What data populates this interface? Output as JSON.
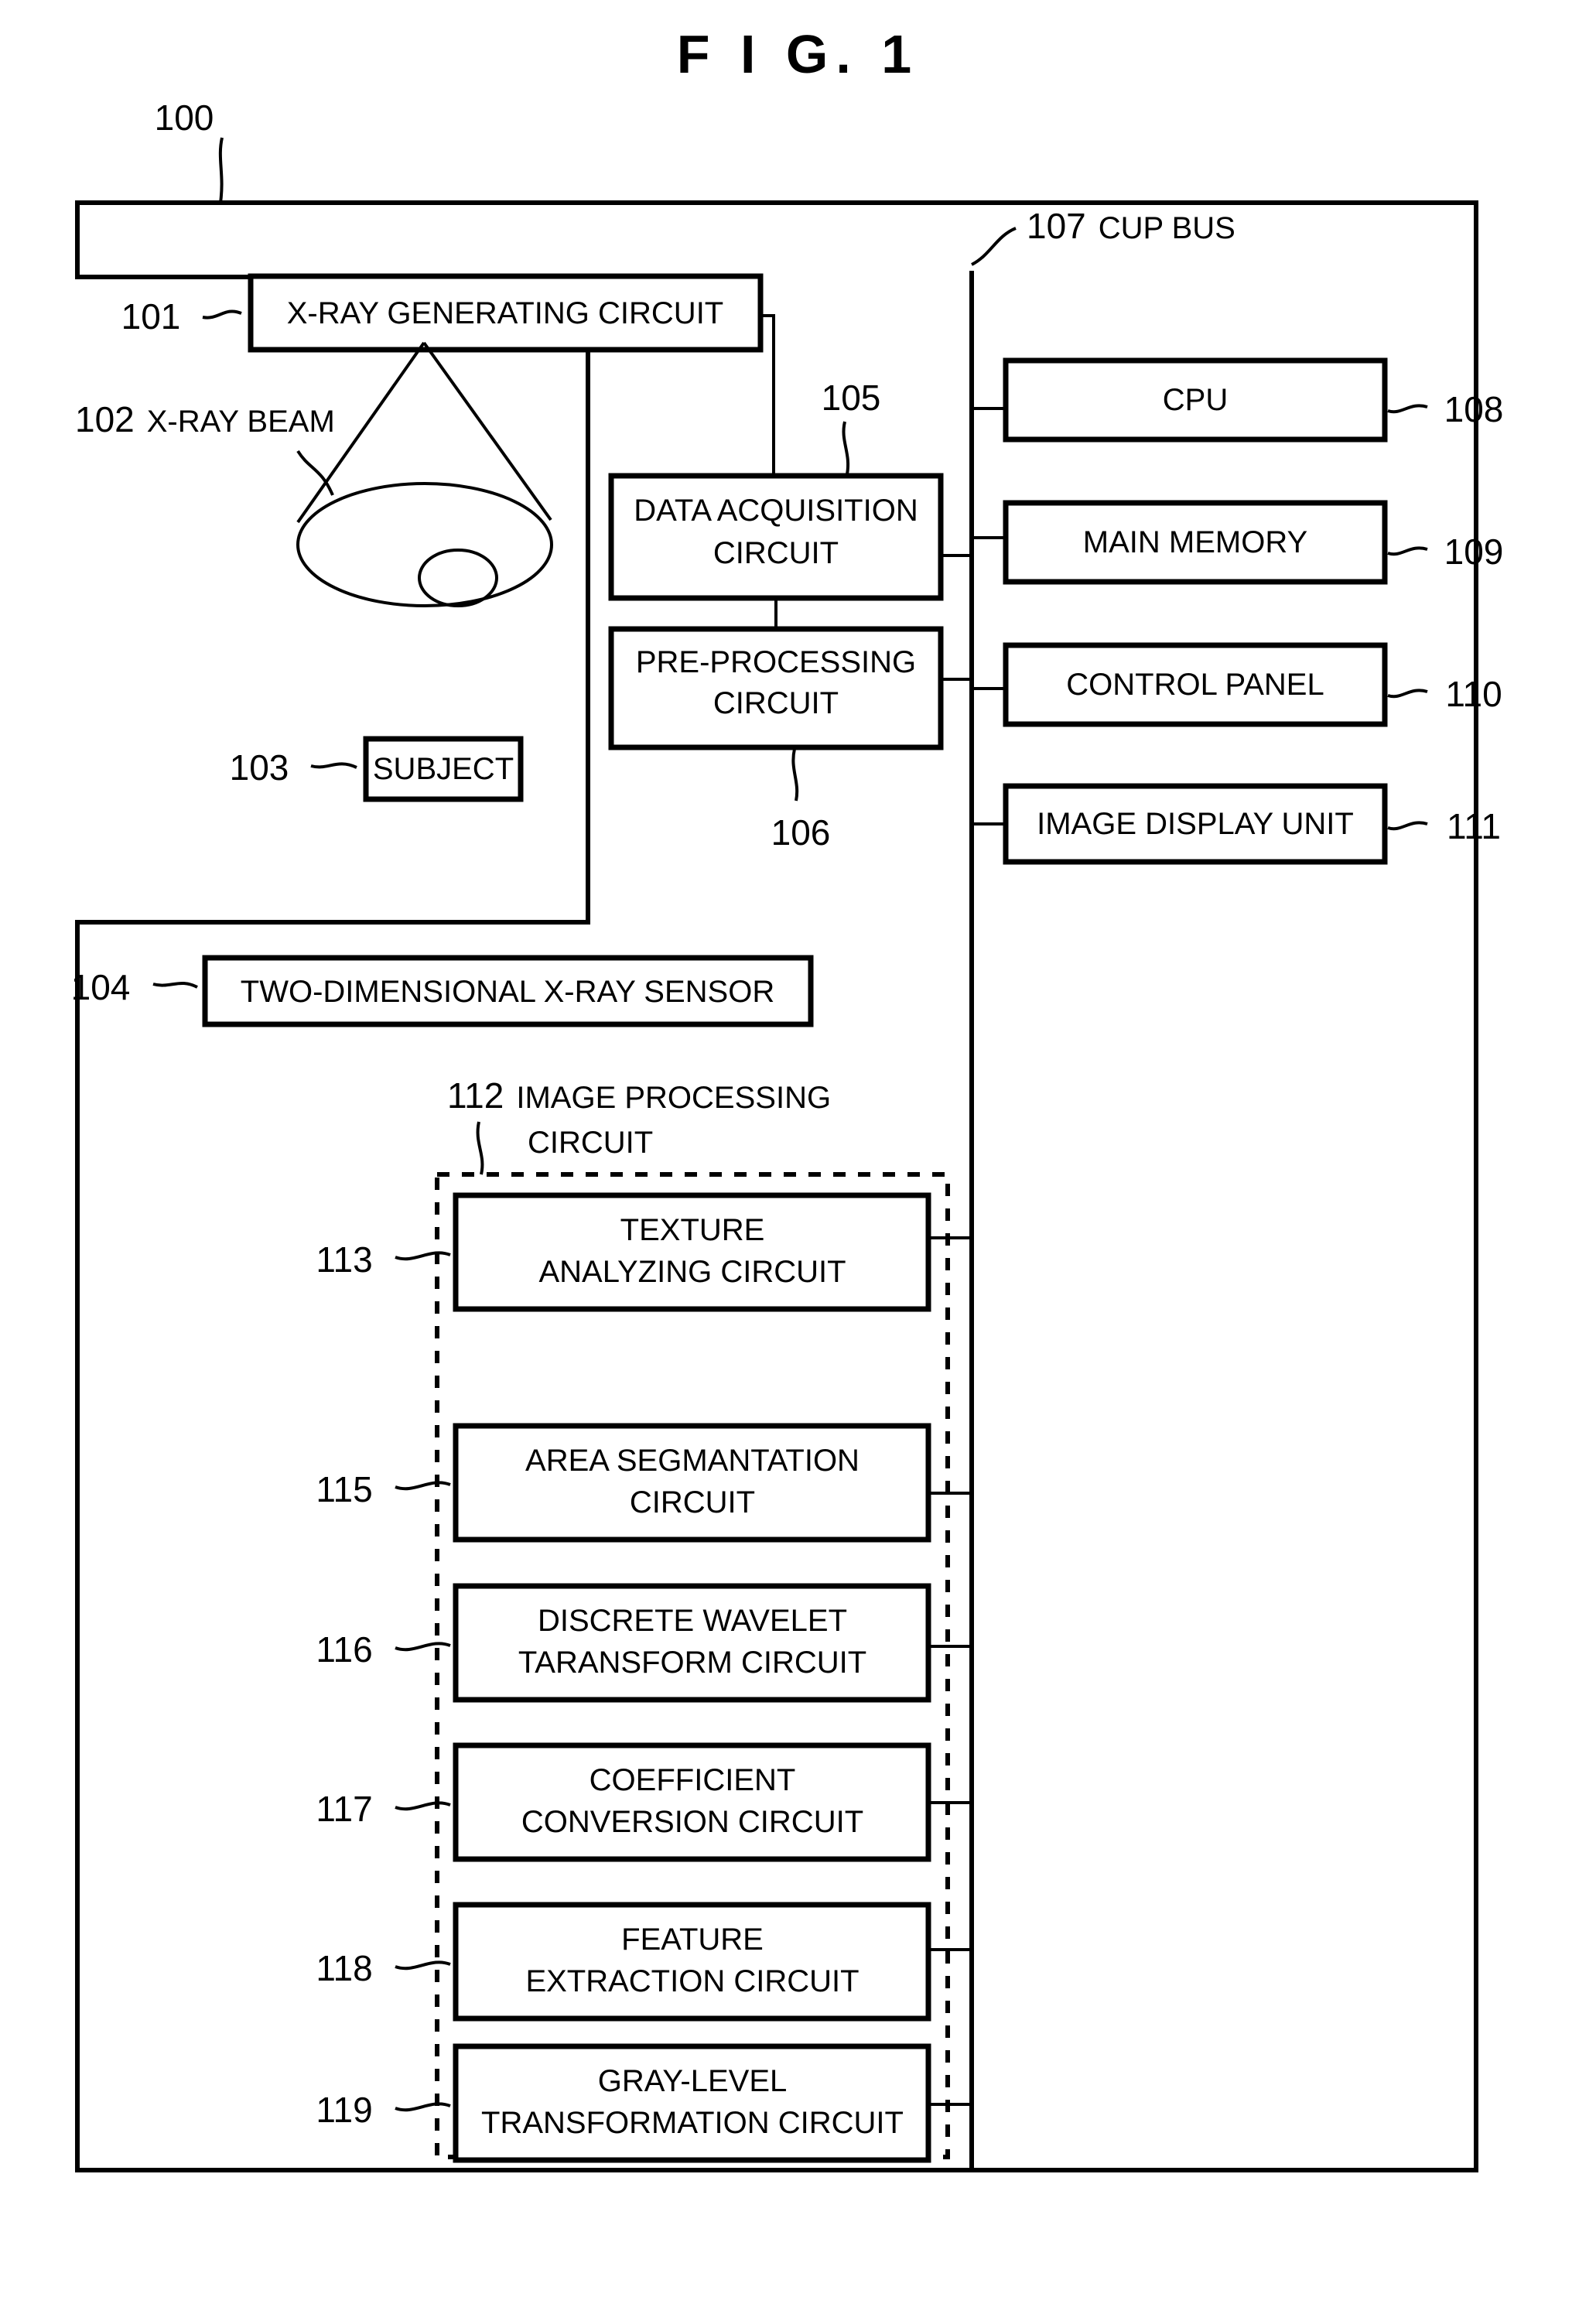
{
  "figure": {
    "title": "F I G.  1",
    "system_ref": "100"
  },
  "labels": {
    "xray_generating_ref": "101",
    "xray_generating_text": "X-RAY GENERATING CIRCUIT",
    "xray_beam_ref": "102",
    "xray_beam_text": "X-RAY BEAM",
    "subject_ref": "103",
    "subject_text": "SUBJECT",
    "sensor_ref": "104",
    "sensor_text": "TWO-DIMENSIONAL X-RAY SENSOR",
    "data_acq_ref": "105",
    "data_acq_line1": "DATA ACQUISITION",
    "data_acq_line2": "CIRCUIT",
    "preproc_ref": "106",
    "preproc_line1": "PRE-PROCESSING",
    "preproc_line2": "CIRCUIT",
    "bus_ref": "107",
    "bus_text": "CUP BUS",
    "cpu_ref": "108",
    "cpu_text": "CPU",
    "main_memory_ref": "109",
    "main_memory_text": "MAIN MEMORY",
    "control_panel_ref": "110",
    "control_panel_text": "CONTROL PANEL",
    "image_display_ref": "111",
    "image_display_text": "IMAGE DISPLAY UNIT",
    "image_proc_ref": "112",
    "image_proc_line1": "IMAGE PROCESSING",
    "image_proc_line2": "CIRCUIT",
    "texture_ref": "113",
    "texture_line1": "TEXTURE",
    "texture_line2": "ANALYZING CIRCUIT",
    "area_seg_ref": "115",
    "area_seg_line1": "AREA SEGMANTATION",
    "area_seg_line2": "CIRCUIT",
    "wavelet_ref": "116",
    "wavelet_line1": "DISCRETE WAVELET",
    "wavelet_line2": "TARANSFORM CIRCUIT",
    "coeff_ref": "117",
    "coeff_line1": "COEFFICIENT",
    "coeff_line2": "CONVERSION CIRCUIT",
    "feature_ref": "118",
    "feature_line1": "FEATURE",
    "feature_line2": "EXTRACTION CIRCUIT",
    "gray_ref": "119",
    "gray_line1": "GRAY-LEVEL",
    "gray_line2": "TRANSFORMATION CIRCUIT"
  },
  "chart_data": {
    "type": "diagram",
    "title": "F I G.  1",
    "description": "Block diagram of an X-ray imaging apparatus",
    "nodes": [
      {
        "ref": "100",
        "label": "",
        "kind": "outer-frame"
      },
      {
        "ref": "101",
        "label": "X-RAY GENERATING CIRCUIT",
        "kind": "box"
      },
      {
        "ref": "102",
        "label": "X-RAY BEAM",
        "kind": "annotation"
      },
      {
        "ref": "103",
        "label": "SUBJECT",
        "kind": "box"
      },
      {
        "ref": "104",
        "label": "TWO-DIMENSIONAL X-RAY SENSOR",
        "kind": "box"
      },
      {
        "ref": "105",
        "label": "DATA ACQUISITION CIRCUIT",
        "kind": "box"
      },
      {
        "ref": "106",
        "label": "PRE-PROCESSING CIRCUIT",
        "kind": "box"
      },
      {
        "ref": "107",
        "label": "CUP BUS",
        "kind": "bus"
      },
      {
        "ref": "108",
        "label": "CPU",
        "kind": "box"
      },
      {
        "ref": "109",
        "label": "MAIN MEMORY",
        "kind": "box"
      },
      {
        "ref": "110",
        "label": "CONTROL PANEL",
        "kind": "box"
      },
      {
        "ref": "111",
        "label": "IMAGE DISPLAY UNIT",
        "kind": "box"
      },
      {
        "ref": "112",
        "label": "IMAGE PROCESSING CIRCUIT",
        "kind": "dashed-group"
      },
      {
        "ref": "113",
        "label": "TEXTURE ANALYZING CIRCUIT",
        "kind": "box"
      },
      {
        "ref": "115",
        "label": "AREA SEGMANTATION CIRCUIT",
        "kind": "box"
      },
      {
        "ref": "116",
        "label": "DISCRETE WAVELET TARANSFORM CIRCUIT",
        "kind": "box"
      },
      {
        "ref": "117",
        "label": "COEFFICIENT CONVERSION CIRCUIT",
        "kind": "box"
      },
      {
        "ref": "118",
        "label": "FEATURE EXTRACTION CIRCUIT",
        "kind": "box"
      },
      {
        "ref": "119",
        "label": "GRAY-LEVEL TRANSFORMATION CIRCUIT",
        "kind": "box"
      }
    ],
    "edges": [
      {
        "from": "101",
        "to": "105"
      },
      {
        "from": "105",
        "to": "106"
      },
      {
        "from": "105",
        "to": "107"
      },
      {
        "from": "106",
        "to": "107"
      },
      {
        "from": "107",
        "to": "108"
      },
      {
        "from": "107",
        "to": "109"
      },
      {
        "from": "107",
        "to": "110"
      },
      {
        "from": "107",
        "to": "111"
      },
      {
        "from": "107",
        "to": "113"
      },
      {
        "from": "107",
        "to": "115"
      },
      {
        "from": "107",
        "to": "116"
      },
      {
        "from": "107",
        "to": "117"
      },
      {
        "from": "107",
        "to": "118"
      },
      {
        "from": "107",
        "to": "119"
      }
    ]
  }
}
